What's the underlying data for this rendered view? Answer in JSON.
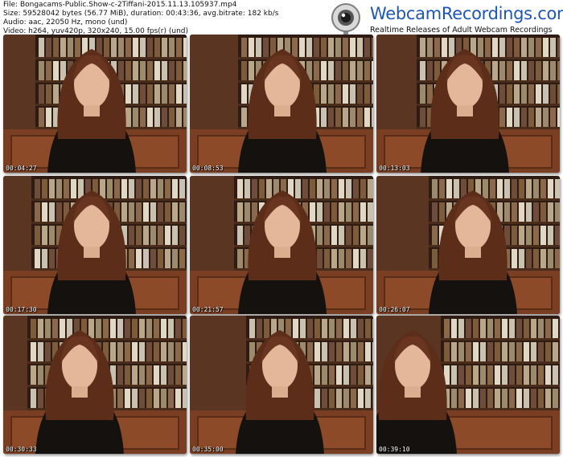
{
  "file_info": {
    "file": "File: Bongacams-Public.Show-c-2Tiffani-2015.11.13.105937.mp4",
    "size": "Size: 59528042 bytes (56.77 MiB), duration: 00:43:36, avg.bitrate: 182 kb/s",
    "audio": "Audio: aac, 22050 Hz, mono (und)",
    "video": "Video: h264, yuv420p, 320x240, 15.00 fps(r) (und)"
  },
  "logo": {
    "brand": "WebcamRecordings.com",
    "tagline": "Realtime Releases of Adult Webcam Recordings",
    "icon": "webcam-icon"
  },
  "thumbnails": [
    {
      "timestamp": "00:04:27"
    },
    {
      "timestamp": "00:08:53"
    },
    {
      "timestamp": "00:13:03"
    },
    {
      "timestamp": "00:17:30"
    },
    {
      "timestamp": "00:21:57"
    },
    {
      "timestamp": "00:26:07"
    },
    {
      "timestamp": "00:30:33"
    },
    {
      "timestamp": "00:35:00"
    },
    {
      "timestamp": "00:39:10"
    }
  ]
}
